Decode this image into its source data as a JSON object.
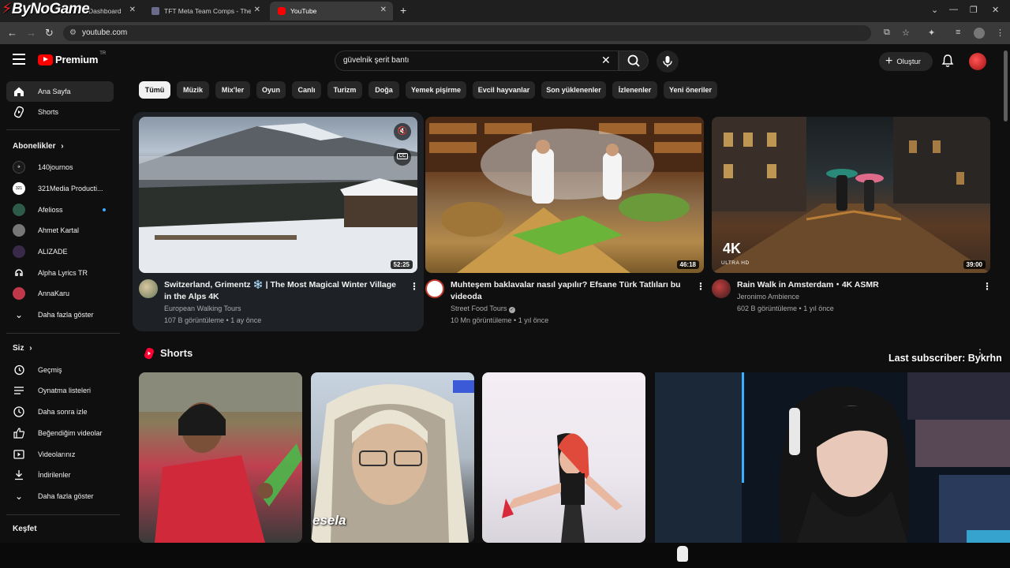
{
  "browser": {
    "tabs": [
      {
        "label": "Dashboard"
      },
      {
        "label": "TFT Meta Team Comps - The Be"
      },
      {
        "label": "YouTube"
      }
    ],
    "new_tab": "+",
    "url": "youtube.com",
    "overlay_logo": "ByNoGame"
  },
  "header": {
    "logo_text": "Premium",
    "logo_region": "TR",
    "search_value": "güvelnik şerit bantı",
    "create_label": "Oluştur"
  },
  "sidebar": {
    "main": [
      {
        "label": "Ana Sayfa",
        "icon": "home-icon"
      },
      {
        "label": "Shorts",
        "icon": "shorts-icon"
      }
    ],
    "subs_title": "Abonelikler",
    "subscriptions": [
      {
        "label": "140journos",
        "color": "#1a1a1a"
      },
      {
        "label": "321Media Producti...",
        "color": "#ffffff"
      },
      {
        "label": "Afelioss",
        "color": "#2e5a4a"
      },
      {
        "label": "Ahmet Kartal",
        "color": "#555555"
      },
      {
        "label": "ALIZADE",
        "color": "#3a2a4a"
      },
      {
        "label": "Alpha Lyrics TR",
        "color": "#111111"
      },
      {
        "label": "AnnaKaru",
        "color": "#c0394b"
      }
    ],
    "subs_more": "Daha fazla göster",
    "you_title": "Siz",
    "you_items": [
      {
        "label": "Geçmiş",
        "icon": "history-icon"
      },
      {
        "label": "Oynatma listeleri",
        "icon": "playlist-icon"
      },
      {
        "label": "Daha sonra izle",
        "icon": "watch-later-icon"
      },
      {
        "label": "Beğendiğim videolar",
        "icon": "like-icon"
      },
      {
        "label": "Videolarınız",
        "icon": "your-videos-icon"
      },
      {
        "label": "İndirilenler",
        "icon": "download-icon"
      }
    ],
    "you_more": "Daha fazla göster",
    "explore_title": "Keşfet"
  },
  "chips": [
    "Tümü",
    "Müzik",
    "Mix'ler",
    "Oyun",
    "Canlı",
    "Turizm",
    "Doğa",
    "Yemek pişirme",
    "Evcil hayvanlar",
    "Son yüklenenler",
    "İzlenenler",
    "Yeni öneriler"
  ],
  "videos": [
    {
      "title": "Switzerland, Grimentz ❄️ | The Most Magical Winter Village in the Alps 4K",
      "channel": "European Walking Tours",
      "meta": "107 B görüntüleme • 1 ay önce",
      "duration": "52:25"
    },
    {
      "title": "Muhteşem baklavalar nasıl yapılır? Efsane Türk Tatlıları bu videoda",
      "channel": "Street Food Tours",
      "meta": "10 Mn görüntüleme • 1 yıl önce",
      "duration": "46:18"
    },
    {
      "title": "Rain Walk in Amsterdam・4K ASMR",
      "channel": "Jeronimo Ambience",
      "meta": "602 B görüntüleme • 1 yıl önce",
      "duration": "39:00",
      "badge": "4K",
      "badge_sub": "ULTRA HD"
    }
  ],
  "shorts_title": "Shorts",
  "short_text": "esela",
  "last_subscriber": "Last subscriber: Bykrhn"
}
